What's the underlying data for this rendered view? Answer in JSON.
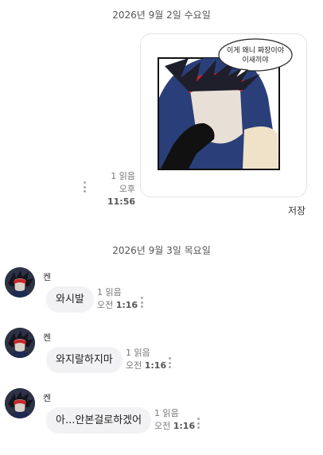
{
  "date_separators": [
    "2026년 9월 2일 수요일",
    "2026년 9월 3일 목요일"
  ],
  "sent_image": {
    "speech_text_line1": "이게 왜니 짜장이야",
    "speech_text_line2": "이새끼야",
    "read_status": "1 읽음",
    "time_ampm": "오후",
    "time_clock": "11:56",
    "save_label": "저장"
  },
  "received_messages": [
    {
      "sender": "켄",
      "text": "와시발",
      "read_status": "1 읽음",
      "time_ampm": "오전",
      "time_clock": "1:16"
    },
    {
      "sender": "켄",
      "text": "와지랄하지마",
      "read_status": "1 읽음",
      "time_ampm": "오전",
      "time_clock": "1:16"
    },
    {
      "sender": "켄",
      "text": "아...안본걸로하겠어",
      "read_status": "1 읽음",
      "time_ampm": "오전",
      "time_clock": "1:16"
    }
  ],
  "colors": {
    "bubble_bg": "#f2f2f4",
    "hair": "#1e1f2b",
    "hood": "#2a3f7a",
    "bandana": "#c8262a"
  }
}
